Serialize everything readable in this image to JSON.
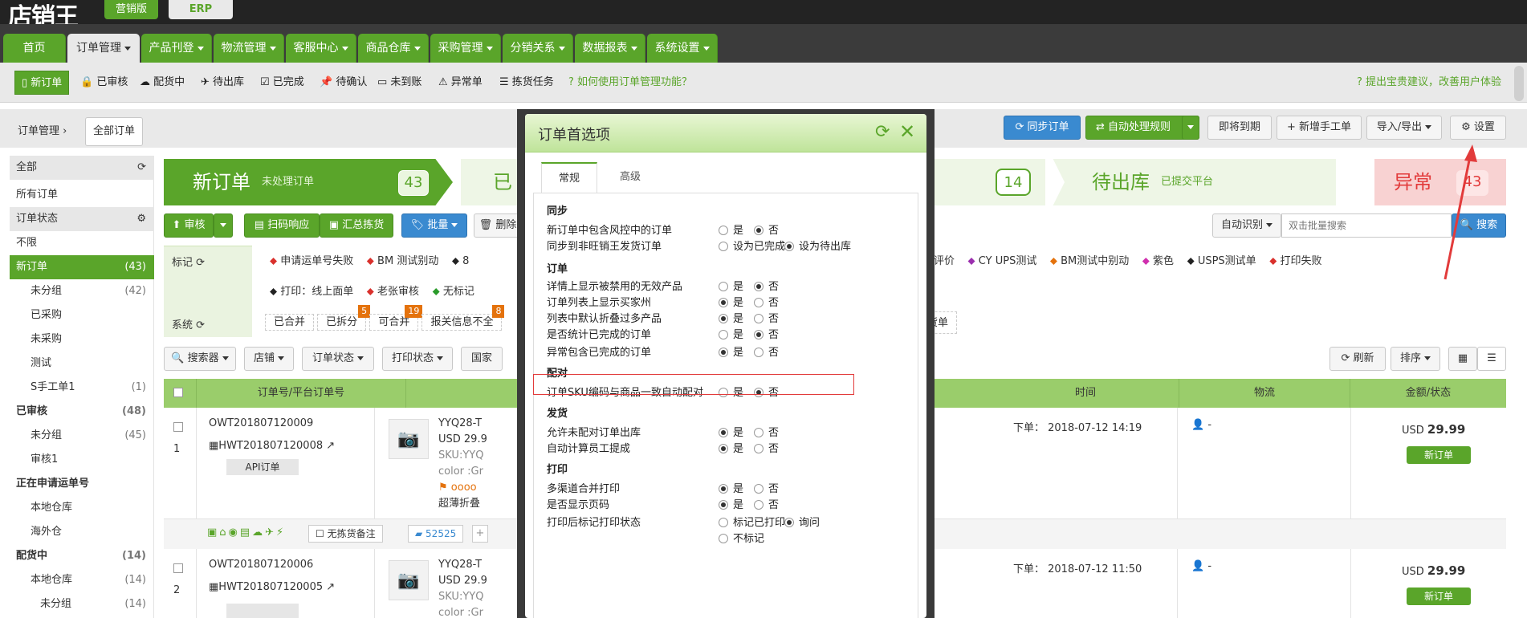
{
  "top": {
    "logo": "店销王",
    "edition_marketing": "营销版",
    "edition_erp": "ERP"
  },
  "nav": {
    "tabs": [
      "首页",
      "订单管理",
      "产品刊登",
      "物流管理",
      "客服中心",
      "商品仓库",
      "采购管理",
      "分销关系",
      "数据报表",
      "系统设置"
    ]
  },
  "subnav": {
    "items": [
      "新订单",
      "已审核",
      "配货中",
      "待出库",
      "已完成",
      "待确认",
      "未到账",
      "异常单",
      "拣货任务"
    ],
    "help": "如何使用订单管理功能？",
    "feedback": "提出宝贵建议，改善用户体验"
  },
  "breadcrumb": {
    "root": "订单管理",
    "current": "全部订单"
  },
  "actions": {
    "sync": "同步订单",
    "auto_rule": "自动处理规则",
    "due": "即将到期",
    "new_manual": "新增手工单",
    "import_export": "导入/导出",
    "settings": "设置"
  },
  "sidebar": {
    "items": [
      {
        "label": "全部",
        "count": "",
        "type": "head"
      },
      {
        "label": "所有订单",
        "count": "",
        "type": "item"
      },
      {
        "label": "订单状态",
        "count": "",
        "type": "head"
      },
      {
        "label": "不限",
        "count": "",
        "type": "item"
      },
      {
        "label": "新订单",
        "count": "(43)",
        "type": "active"
      },
      {
        "label": "未分组",
        "count": "(42)",
        "type": "sub"
      },
      {
        "label": "已采购",
        "count": "",
        "type": "sub"
      },
      {
        "label": "未采购",
        "count": "",
        "type": "sub"
      },
      {
        "label": "测试",
        "count": "",
        "type": "sub"
      },
      {
        "label": "S手工单1",
        "count": "(1)",
        "type": "sub"
      },
      {
        "label": "已审核",
        "count": "(48)",
        "type": "bold"
      },
      {
        "label": "未分组",
        "count": "(45)",
        "type": "sub"
      },
      {
        "label": "审核1",
        "count": "",
        "type": "sub"
      },
      {
        "label": "正在申请运单号",
        "count": "",
        "type": "bold"
      },
      {
        "label": "本地仓库",
        "count": "",
        "type": "sub"
      },
      {
        "label": "海外仓",
        "count": "",
        "type": "sub"
      },
      {
        "label": "配货中",
        "count": "(14)",
        "type": "bold"
      },
      {
        "label": "本地仓库",
        "count": "(14)",
        "type": "sub"
      },
      {
        "label": "未分组",
        "count": "(14)",
        "type": "sub2"
      }
    ]
  },
  "status_tabs": {
    "new": {
      "title": "新订单",
      "sub": "未处理订单",
      "count": "43"
    },
    "reviewed": {
      "title": "已审"
    },
    "picking_count": "14",
    "pending": {
      "title": "待出库",
      "sub": "已提交平台"
    },
    "error": {
      "title": "异常",
      "count": "43"
    }
  },
  "toolbar": {
    "review": "审核",
    "scan": "扫码响应",
    "summary": "汇总拣货",
    "batch": "批量",
    "delete": "删除",
    "auto_detect": "自动识别",
    "search_placeholder": "双击批量搜索",
    "search": "搜索"
  },
  "tags": {
    "label_mark": "标记",
    "label_system": "系统",
    "row1": [
      "申请运单号失败",
      "BM 测试别动",
      "8"
    ],
    "row1_right": [
      "不评价",
      "CY UPS测试",
      "BM测试中别动",
      "紫色",
      "USPS测试单",
      "打印失败"
    ],
    "row2": [
      "打印：线上面单",
      "老张审核",
      "无标记"
    ],
    "system": [
      {
        "label": "已合并",
        "badge": ""
      },
      {
        "label": "已拆分",
        "badge": "5"
      },
      {
        "label": "可合并",
        "badge": "19"
      },
      {
        "label": "报关信息不全",
        "badge": "8"
      }
    ],
    "system_right": "货单"
  },
  "filters": {
    "searcher": "搜索器",
    "shop": "店铺",
    "order_status": "订单状态",
    "print_status": "打印状态",
    "country": "国家",
    "refresh": "刷新",
    "sort": "排序"
  },
  "table": {
    "headers": {
      "order_no": "订单号/平台订单号",
      "time": "时间",
      "logistics": "物流",
      "amount": "金额/状态"
    },
    "rows": [
      {
        "num": "1",
        "order": "OWT201807120009",
        "platform": "HWT201807120008",
        "source": "API订单",
        "sku": "YYQ28-T",
        "usd": "USD 29.9",
        "skuline": "SKU:YYQ",
        "color": "color :Gr",
        "flag": "oooo",
        "desc": "超薄折叠",
        "time": "下单： 2018-07-12 14:19",
        "logi": "-",
        "amt_cur": "USD",
        "amt": "29.99",
        "status": "新订单",
        "note": "无拣货备注",
        "id": "52525"
      },
      {
        "num": "2",
        "order": "OWT201807120006",
        "platform": "HWT201807120005",
        "source": "",
        "sku": "YYQ28-T",
        "usd": "USD 29.9",
        "skuline": "SKU:YYQ",
        "color": "color :Gr",
        "flag": "",
        "desc": "",
        "time": "下单： 2018-07-12 11:50",
        "logi": "-",
        "amt_cur": "USD",
        "amt": "29.99",
        "status": "新订单",
        "note": "",
        "id": ""
      }
    ]
  },
  "dialog": {
    "title": "订单首选项",
    "tabs": [
      "常规",
      "高级"
    ],
    "sections": {
      "sync": "同步",
      "order": "订单",
      "match": "配对",
      "ship": "发货",
      "print": "打印"
    },
    "rows": [
      {
        "label": "新订单中包含风控中的订单",
        "a": "是",
        "b": "否",
        "sel": "b"
      },
      {
        "label": "同步到非旺销王发货订单",
        "a": "设为已完成",
        "b": "设为待出库",
        "sel": "b"
      },
      {
        "label": "详情上显示被禁用的无效产品",
        "a": "是",
        "b": "否",
        "sel": "b"
      },
      {
        "label": "订单列表上显示买家州",
        "a": "是",
        "b": "否",
        "sel": "a"
      },
      {
        "label": "列表中默认折叠过多产品",
        "a": "是",
        "b": "否",
        "sel": "a"
      },
      {
        "label": "是否统计已完成的订单",
        "a": "是",
        "b": "否",
        "sel": "b"
      },
      {
        "label": "异常包含已完成的订单",
        "a": "是",
        "b": "否",
        "sel": "a"
      },
      {
        "label": "订单SKU编码与商品一致自动配对",
        "a": "是",
        "b": "否",
        "sel": "b"
      },
      {
        "label": "允许未配对订单出库",
        "a": "是",
        "b": "否",
        "sel": "a"
      },
      {
        "label": "自动计算员工提成",
        "a": "是",
        "b": "否",
        "sel": "a"
      },
      {
        "label": "多渠道合并打印",
        "a": "是",
        "b": "否",
        "sel": "a"
      },
      {
        "label": "是否显示页码",
        "a": "是",
        "b": "否",
        "sel": "a"
      },
      {
        "label": "打印后标记打印状态",
        "a": "标记已打印",
        "b": "询问",
        "sel": "b"
      }
    ],
    "extra_option": "不标记"
  },
  "colors": {
    "green": "#5aa52a",
    "blue": "#3a8ad0",
    "red": "#e23b3b",
    "tag_red": "#d9302c"
  }
}
